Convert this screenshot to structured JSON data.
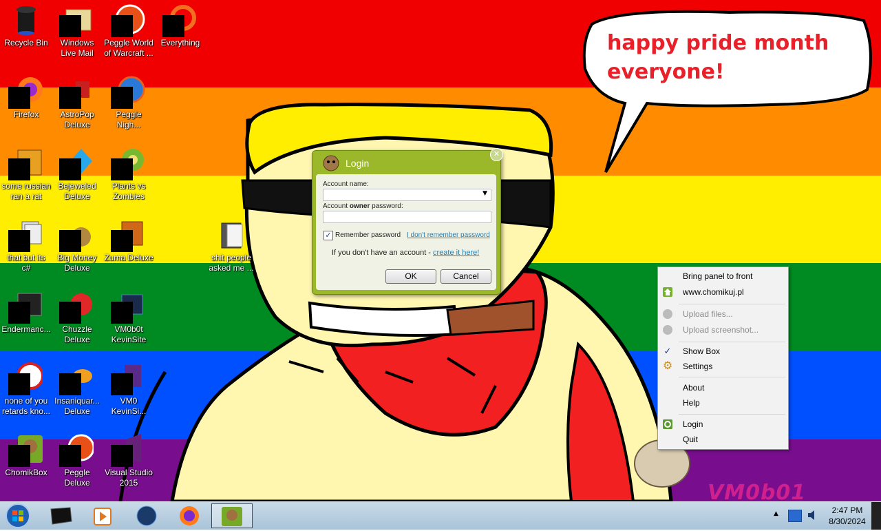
{
  "wallpaper": {
    "speech_bubble": "happy pride month\neveryone!",
    "signature": "VM0b01",
    "stripe_colors": [
      "#f00000",
      "#ff8c00",
      "#ffee00",
      "#008a22",
      "#0050ff",
      "#780e8e"
    ]
  },
  "desktop_icons": [
    {
      "id": "recycle-bin",
      "label": "Recycle Bin"
    },
    {
      "id": "windows-live-mail",
      "label": "Windows\nLive Mail"
    },
    {
      "id": "peggle-world-of-warcraft",
      "label": "Peggle World\nof Warcraft ..."
    },
    {
      "id": "everything",
      "label": "Everything"
    },
    {
      "id": "firefox",
      "label": "Firefox"
    },
    {
      "id": "astropop-deluxe",
      "label": "AstroPop\nDeluxe"
    },
    {
      "id": "peggle-nights",
      "label": "Peggle\nNigh..."
    },
    {
      "id": "some-russian-ran-a-rat",
      "label": "some russian\nran a rat"
    },
    {
      "id": "bejeweled-deluxe",
      "label": "Bejeweled\nDeluxe"
    },
    {
      "id": "plants-vs-zombies",
      "label": "Plants vs\nZombies"
    },
    {
      "id": "that-but-its-csharp",
      "label": "that but its\nc#"
    },
    {
      "id": "big-money-deluxe",
      "label": "Big Money\nDeluxe"
    },
    {
      "id": "zuma-deluxe",
      "label": "Zuma Deluxe"
    },
    {
      "id": "shit-people-asked-me",
      "label": "shit people\nasked me ..."
    },
    {
      "id": "endermanc",
      "label": "Endermanc..."
    },
    {
      "id": "chuzzle-deluxe",
      "label": "Chuzzle\nDeluxe"
    },
    {
      "id": "vm0b0t-kevinsite",
      "label": "VM0b0t\nKevinSite"
    },
    {
      "id": "none-of-you-retards",
      "label": "none of you\nretards kno..."
    },
    {
      "id": "insaniquarium-deluxe",
      "label": "Insaniquar...\nDeluxe"
    },
    {
      "id": "vm0-kevinsi",
      "label": "VM0\nKevinSi..."
    },
    {
      "id": "chomikbox",
      "label": "ChomikBox"
    },
    {
      "id": "peggle-deluxe",
      "label": "Peggle\nDeluxe"
    },
    {
      "id": "visual-studio-2015",
      "label": "Visual Studio\n2015"
    }
  ],
  "login_dialog": {
    "title": "Login",
    "account_name_label": "Account name:",
    "account_name_value": "",
    "password_label_pre": "Account ",
    "password_label_bold": "owner",
    "password_label_post": " password:",
    "password_value": "",
    "remember_label": "Remember password",
    "remember_checked": true,
    "forgot_link": "I don't remember password",
    "no_account_text": "If you don't have an account - ",
    "create_link": "create it here!",
    "ok_label": "OK",
    "cancel_label": "Cancel"
  },
  "context_menu": {
    "items": [
      {
        "label": "Bring panel to front",
        "enabled": true
      },
      {
        "label": "www.chomikuj.pl",
        "enabled": true,
        "icon": "home-icon"
      },
      {
        "label": "Upload files...",
        "enabled": false,
        "icon": "upload-files-icon"
      },
      {
        "label": "Upload screenshot...",
        "enabled": false,
        "icon": "upload-screenshot-icon"
      },
      {
        "label": "Show Box",
        "enabled": true,
        "checked": true
      },
      {
        "label": "Settings",
        "enabled": true,
        "icon": "gear-icon"
      },
      {
        "label": "About",
        "enabled": true
      },
      {
        "label": "Help",
        "enabled": true
      },
      {
        "label": "Login",
        "enabled": true,
        "icon": "login-icon"
      },
      {
        "label": "Quit",
        "enabled": true
      }
    ]
  },
  "taskbar": {
    "pinned": [
      "start-orb",
      "cmd-window",
      "media-player",
      "network-globe",
      "firefox",
      "chomikbox"
    ],
    "active_app": "chomikbox",
    "clock_time": "2:47 PM",
    "clock_date": "8/30/2024"
  }
}
